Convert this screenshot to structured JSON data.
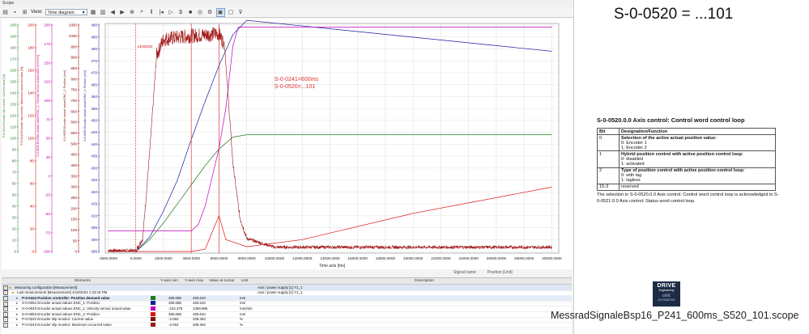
{
  "window": {
    "title": "Scope"
  },
  "toolbar": {
    "view_label": "View:",
    "view_value": "Time diagram"
  },
  "plot": {
    "annotation_line1": "S-0-0241=600ms",
    "annotation_line2": "S-0-0520=...101",
    "cursor_label": "14/4/2023",
    "time_axis_title": "Time axis [ms]",
    "x_ticks": [
      "-2000.0000",
      "0.0000",
      "2000.0000",
      "4000.0000",
      "6000.0000",
      "8000.0000",
      "10000.0000",
      "12000.0000",
      "14000.0000",
      "16000.0000",
      "18000.0000",
      "20000.0000",
      "22000.0000",
      "24000.0000",
      "26000.0000",
      "28000.0000",
      "30000.0000"
    ],
    "axes": [
      {
        "color": "#2e7d2e",
        "ticks": [
          "200",
          "190",
          "180",
          "170",
          "160",
          "150",
          "140",
          "130",
          "120",
          "110",
          "100",
          "90",
          "80",
          "70",
          "60",
          "50",
          "40",
          "30",
          "20",
          "10",
          "0"
        ],
        "label": "P-0-0242 Encoder slip monitor: Current value [%]"
      },
      {
        "color": "#c00000",
        "ticks": [
          "200",
          "180",
          "160",
          "140",
          "120",
          "100",
          "80",
          "60",
          "40",
          "20",
          "0"
        ],
        "label": "P-0-0243 Encoder slip monitor: Maximum occurred value [%]"
      },
      {
        "color": "#b000b0",
        "ticks": [
          "200",
          "175",
          "150",
          "125",
          "100",
          "75",
          "50",
          "25",
          "0",
          "-25",
          "-50",
          "-75",
          "-100"
        ],
        "label": "S-0-0040 Encoder actual values ENC_1: Velocity sensor actual value [mm/min]"
      },
      {
        "color": "#8b0000",
        "ticks": [
          "1050",
          "1000",
          "950",
          "900",
          "850",
          "800",
          "750",
          "700",
          "650",
          "600",
          "550",
          "500",
          "450",
          "400",
          "350",
          "300",
          "250",
          "200",
          "150",
          "100",
          "50",
          "0"
        ],
        "label": "S-0-0053 Encoder actual values ENC_2: Position [mm]"
      },
      {
        "color": "#1a1aa0",
        "ticks": [
          "490",
          "485",
          "480",
          "475",
          "470",
          "465",
          "460",
          "455",
          "450",
          "445",
          "440",
          "435",
          "430",
          "425",
          "420",
          "415",
          "410",
          "405",
          "400",
          "395"
        ],
        "label": "S-0-0051 Encoder actual values ENC_1: Position [mm]"
      }
    ]
  },
  "signal_header": {
    "name": "Signal name",
    "position": "Position [Unit]"
  },
  "grid": {
    "headers": [
      "Elements",
      "Y-axis min",
      "Y-axis max",
      "Value at cursor",
      "Unit",
      "Description"
    ],
    "config_row": "Measuring configuration [Measurement]",
    "config_desc": "Axis / power supply [1] Y1_1",
    "last_row": "Last measurement [Measurement] 4/18/2023 1:33:18 PM",
    "last_desc": "Axis / power supply [1] Y1_1",
    "rows": [
      {
        "name": "P-0-0434 Position controller: Position demand value",
        "color": "#1f7a1f",
        "min": "390.088",
        "max": "493.610",
        "val": "",
        "unit": "mm",
        "bold": true
      },
      {
        "name": "S-0-0051 Encoder actual values ENC_1: Position",
        "color": "#1a1aa0",
        "min": "390.088",
        "max": "493.610",
        "val": "",
        "unit": "mm",
        "bold": false
      },
      {
        "name": "S-0-0040 Encoder actual values ENC_1: Velocity sensor actual value",
        "color": "#c000c0",
        "min": "-102.379",
        "max": "1098.985",
        "val": "",
        "unit": "mm/min",
        "bold": false
      },
      {
        "name": "S-0-0053 Encoder actual values ENC_2: Position",
        "color": "#e01010",
        "min": "390.088",
        "max": "493.610",
        "val": "",
        "unit": "mm",
        "bold": false
      },
      {
        "name": "P-0-0242 Encoder slip monitor: Current value",
        "color": "#7a1010",
        "min": "-2.063",
        "max": "208.363",
        "val": "",
        "unit": "%",
        "bold": false
      },
      {
        "name": "P-0-0243 Encoder slip monitor: Maximum occurred value",
        "color": "#a01818",
        "min": "-2.063",
        "max": "208.363",
        "val": "",
        "unit": "%",
        "bold": false
      }
    ]
  },
  "right": {
    "big_title": "S-0-0520 = ...101",
    "param_title": "S-0-0520.0.0  Axis control: Control word control loop",
    "table_headers": [
      "Bit",
      "Designation/Function"
    ],
    "table_rows": [
      {
        "bit": "0",
        "title": "Selection of the active actual position value:",
        "l1": "0: Encoder 1",
        "l2": "1: Encoder 2",
        "l3": ""
      },
      {
        "bit": "1",
        "title": "Hybrid position control with active position control loop:",
        "l1": "0: disabled",
        "l2": "1: activated",
        "l3": ""
      },
      {
        "bit": "2",
        "title": "Type of position control with active position control loop:",
        "l1": "0: with lag",
        "l2": "1: lagless",
        "l3": ""
      },
      {
        "bit": "15-3",
        "title": "reserved",
        "l1": "",
        "l2": "",
        "l3": ""
      }
    ],
    "note": "The selection in S-0-0520.0.0  Axis control: Control word control loop  is acknowledged in S-0-0521.0.0 Axis control: Status word control loop.",
    "logo_line1": "DRIVE",
    "logo_line2": "Engineering",
    "logo_line3": "ctrlX",
    "logo_line4": "AUTOMATION",
    "filename": "MessradSignaleBsp16_P241_600ms_S520_101.scope"
  },
  "chart_data": {
    "type": "line",
    "title": "",
    "xlabel": "Time axis [ms]",
    "xlim": [
      -2200,
      30500
    ],
    "series": [
      {
        "name": "P-0-0434 Position controller: Position demand value",
        "color": "#1f7a1f",
        "x": [
          -2000,
          0,
          1000,
          2000,
          3000,
          4000,
          5000,
          6000,
          7000,
          8000,
          30000
        ],
        "y": [
          395,
          395,
          400,
          407,
          415,
          423,
          431,
          438,
          443,
          444,
          444
        ]
      },
      {
        "name": "S-0-0051 Encoder actual values ENC_1: Position",
        "color": "#1a1aa0",
        "x": [
          -2000,
          0,
          1000,
          2000,
          3000,
          4000,
          5000,
          6000,
          7000,
          8000,
          30000
        ],
        "y": [
          395,
          395,
          401,
          412,
          425,
          442,
          458,
          473,
          486,
          492,
          479
        ]
      },
      {
        "name": "S-0-0040 Encoder actual values ENC_1: Velocity sensor actual value",
        "color": "#c000c0",
        "x": [
          -2000,
          0,
          4000,
          4500,
          5000,
          6000,
          6500,
          7000,
          7400,
          8000,
          30000
        ],
        "y": [
          0,
          0,
          0,
          30,
          120,
          400,
          600,
          900,
          990,
          990,
          990
        ]
      },
      {
        "name": "S-0-0053 Encoder actual values ENC_2: Position",
        "color": "#e01010",
        "x": [
          -2000,
          0,
          2000,
          4000,
          5000,
          6000,
          6500,
          7000,
          8000,
          12000,
          20000,
          30000
        ],
        "y": [
          395,
          395,
          395,
          395,
          396,
          410,
          400,
          399,
          397,
          400,
          411,
          422
        ]
      },
      {
        "name": "P-0-0242 Encoder slip monitor: Current value",
        "color": "#a01818",
        "x": [
          -2000,
          0,
          500,
          1000,
          1500,
          2000,
          4000,
          6000,
          6400,
          7000,
          7500,
          8000,
          10000,
          20000,
          30000
        ],
        "y": [
          -1,
          -1,
          10,
          90,
          180,
          195,
          198,
          200,
          190,
          80,
          30,
          10,
          2,
          2,
          2
        ]
      }
    ]
  }
}
